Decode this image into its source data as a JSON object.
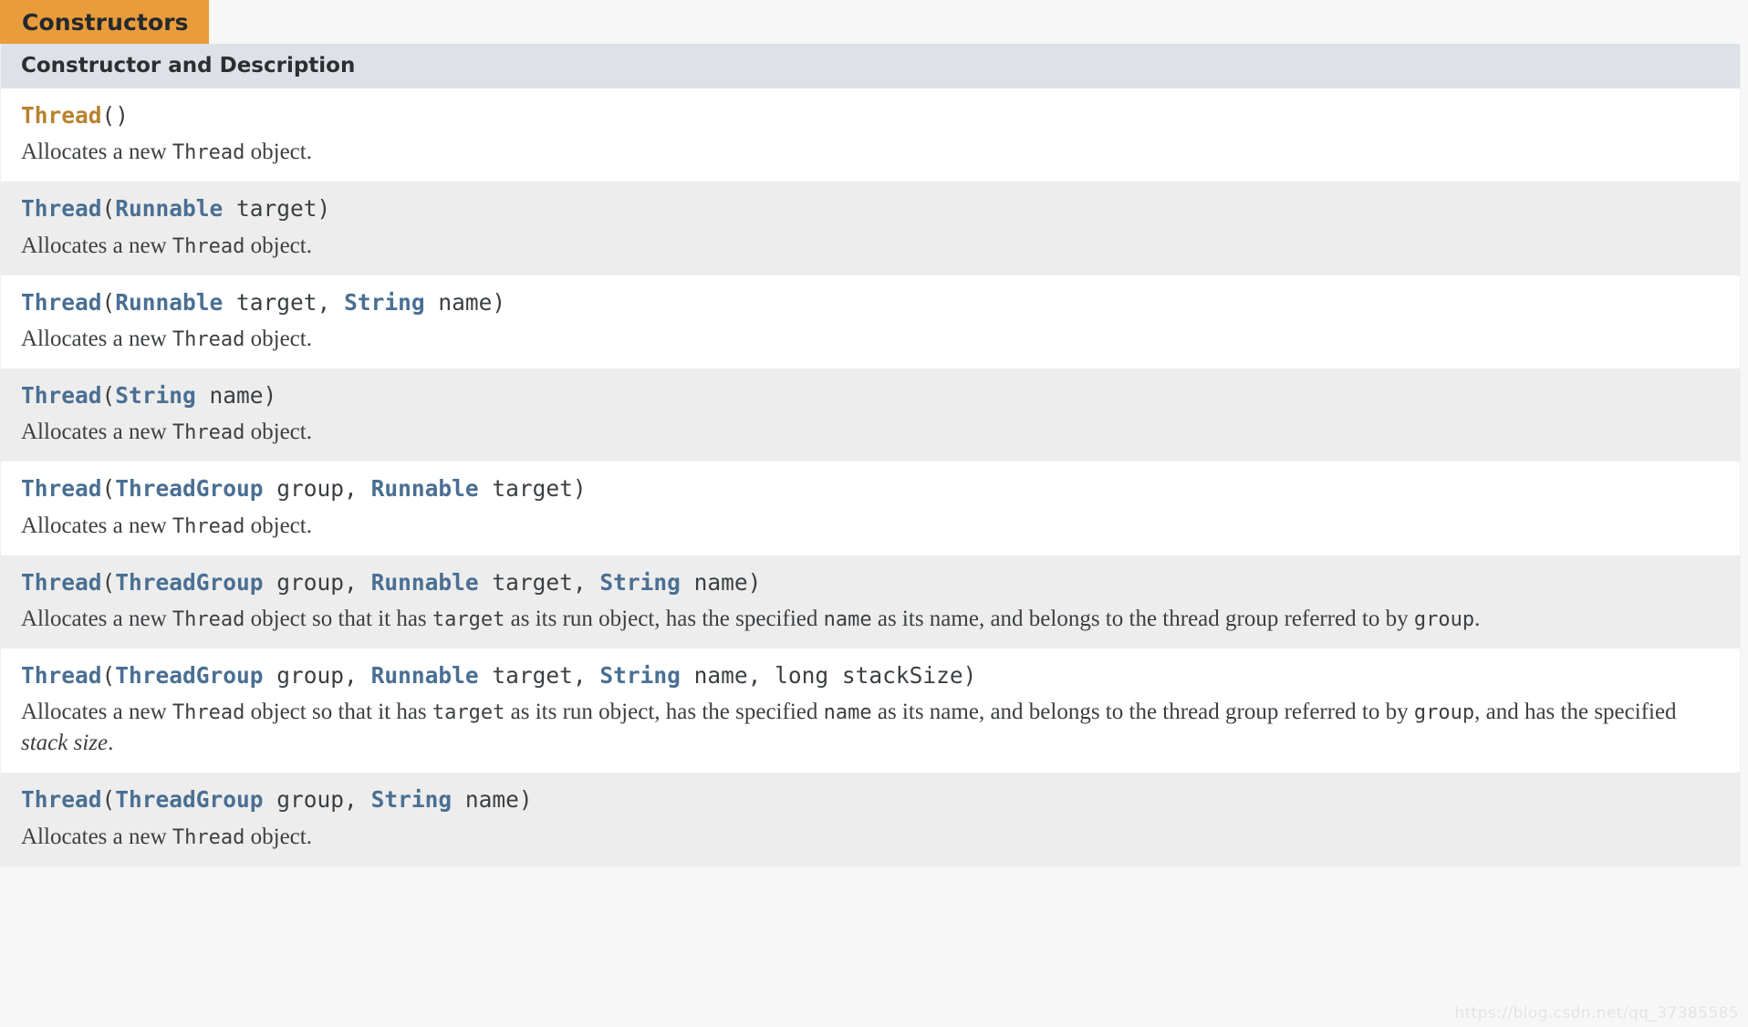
{
  "tab": {
    "label": "Constructors"
  },
  "column_header": {
    "label": "Constructor and Description"
  },
  "watermark": {
    "text": "https://blog.csdn.net/qq_37385585"
  },
  "colors": {
    "tab_background": "#e89c3c",
    "column_header_background": "#dee2e8",
    "row_odd_background": "#ffffff",
    "row_even_background": "#ededed",
    "type_link": "#4a6f93",
    "current_constructor": "#b8822f",
    "body_text": "#3c3f42"
  },
  "rows": [
    {
      "signature": {
        "name": "Thread",
        "highlight": true,
        "full_text": "Thread()",
        "parts": [
          {
            "text": "Thread",
            "style": "ctor-hl"
          },
          {
            "text": "()",
            "style": "punct"
          }
        ]
      },
      "description": {
        "full_text": "Allocates a new Thread object.",
        "parts": [
          {
            "text": "Allocates a new ",
            "style": "plain"
          },
          {
            "text": "Thread",
            "style": "code"
          },
          {
            "text": " object.",
            "style": "plain"
          }
        ]
      }
    },
    {
      "signature": {
        "name": "Thread",
        "highlight": false,
        "full_text": "Thread(Runnable target)",
        "parts": [
          {
            "text": "Thread",
            "style": "ctor"
          },
          {
            "text": "(",
            "style": "punct"
          },
          {
            "text": "Runnable",
            "style": "type"
          },
          {
            "text": " target)",
            "style": "param"
          }
        ]
      },
      "description": {
        "full_text": "Allocates a new Thread object.",
        "parts": [
          {
            "text": "Allocates a new ",
            "style": "plain"
          },
          {
            "text": "Thread",
            "style": "code"
          },
          {
            "text": " object.",
            "style": "plain"
          }
        ]
      }
    },
    {
      "signature": {
        "name": "Thread",
        "highlight": false,
        "full_text": "Thread(Runnable target, String name)",
        "parts": [
          {
            "text": "Thread",
            "style": "ctor"
          },
          {
            "text": "(",
            "style": "punct"
          },
          {
            "text": "Runnable",
            "style": "type"
          },
          {
            "text": " target, ",
            "style": "param"
          },
          {
            "text": "String",
            "style": "type"
          },
          {
            "text": " name)",
            "style": "param"
          }
        ]
      },
      "description": {
        "full_text": "Allocates a new Thread object.",
        "parts": [
          {
            "text": "Allocates a new ",
            "style": "plain"
          },
          {
            "text": "Thread",
            "style": "code"
          },
          {
            "text": " object.",
            "style": "plain"
          }
        ]
      }
    },
    {
      "signature": {
        "name": "Thread",
        "highlight": false,
        "full_text": "Thread(String name)",
        "parts": [
          {
            "text": "Thread",
            "style": "ctor"
          },
          {
            "text": "(",
            "style": "punct"
          },
          {
            "text": "String",
            "style": "type"
          },
          {
            "text": " name)",
            "style": "param"
          }
        ]
      },
      "description": {
        "full_text": "Allocates a new Thread object.",
        "parts": [
          {
            "text": "Allocates a new ",
            "style": "plain"
          },
          {
            "text": "Thread",
            "style": "code"
          },
          {
            "text": " object.",
            "style": "plain"
          }
        ]
      }
    },
    {
      "signature": {
        "name": "Thread",
        "highlight": false,
        "full_text": "Thread(ThreadGroup group, Runnable target)",
        "parts": [
          {
            "text": "Thread",
            "style": "ctor"
          },
          {
            "text": "(",
            "style": "punct"
          },
          {
            "text": "ThreadGroup",
            "style": "type"
          },
          {
            "text": " group, ",
            "style": "param"
          },
          {
            "text": "Runnable",
            "style": "type"
          },
          {
            "text": " target)",
            "style": "param"
          }
        ]
      },
      "description": {
        "full_text": "Allocates a new Thread object.",
        "parts": [
          {
            "text": "Allocates a new ",
            "style": "plain"
          },
          {
            "text": "Thread",
            "style": "code"
          },
          {
            "text": " object.",
            "style": "plain"
          }
        ]
      }
    },
    {
      "signature": {
        "name": "Thread",
        "highlight": false,
        "full_text": "Thread(ThreadGroup group, Runnable target, String name)",
        "parts": [
          {
            "text": "Thread",
            "style": "ctor"
          },
          {
            "text": "(",
            "style": "punct"
          },
          {
            "text": "ThreadGroup",
            "style": "type"
          },
          {
            "text": " group, ",
            "style": "param"
          },
          {
            "text": "Runnable",
            "style": "type"
          },
          {
            "text": " target, ",
            "style": "param"
          },
          {
            "text": "String",
            "style": "type"
          },
          {
            "text": " name)",
            "style": "param"
          }
        ]
      },
      "description": {
        "full_text": "Allocates a new Thread object so that it has target as its run object, has the specified name as its name, and belongs to the thread group referred to by group.",
        "parts": [
          {
            "text": "Allocates a new ",
            "style": "plain"
          },
          {
            "text": "Thread",
            "style": "code"
          },
          {
            "text": " object so that it has ",
            "style": "plain"
          },
          {
            "text": "target",
            "style": "code"
          },
          {
            "text": " as its run object, has the specified ",
            "style": "plain"
          },
          {
            "text": "name",
            "style": "code"
          },
          {
            "text": " as its name, and belongs to the thread group referred to by ",
            "style": "plain"
          },
          {
            "text": "group",
            "style": "code"
          },
          {
            "text": ".",
            "style": "plain"
          }
        ]
      }
    },
    {
      "signature": {
        "name": "Thread",
        "highlight": false,
        "full_text": "Thread(ThreadGroup group, Runnable target, String name, long stackSize)",
        "parts": [
          {
            "text": "Thread",
            "style": "ctor"
          },
          {
            "text": "(",
            "style": "punct"
          },
          {
            "text": "ThreadGroup",
            "style": "type"
          },
          {
            "text": " group, ",
            "style": "param"
          },
          {
            "text": "Runnable",
            "style": "type"
          },
          {
            "text": " target, ",
            "style": "param"
          },
          {
            "text": "String",
            "style": "type"
          },
          {
            "text": " name, long stackSize)",
            "style": "param"
          }
        ]
      },
      "description": {
        "full_text": "Allocates a new Thread object so that it has target as its run object, has the specified name as its name, and belongs to the thread group referred to by group, and has the specified stack size.",
        "parts": [
          {
            "text": "Allocates a new ",
            "style": "plain"
          },
          {
            "text": "Thread",
            "style": "code"
          },
          {
            "text": " object so that it has ",
            "style": "plain"
          },
          {
            "text": "target",
            "style": "code"
          },
          {
            "text": " as its run object, has the specified ",
            "style": "plain"
          },
          {
            "text": "name",
            "style": "code"
          },
          {
            "text": " as its name, and belongs to the thread group referred to by ",
            "style": "plain"
          },
          {
            "text": "group",
            "style": "code"
          },
          {
            "text": ", and has the specified ",
            "style": "plain"
          },
          {
            "text": "stack size",
            "style": "italic"
          },
          {
            "text": ".",
            "style": "plain"
          }
        ]
      }
    },
    {
      "signature": {
        "name": "Thread",
        "highlight": false,
        "full_text": "Thread(ThreadGroup group, String name)",
        "parts": [
          {
            "text": "Thread",
            "style": "ctor"
          },
          {
            "text": "(",
            "style": "punct"
          },
          {
            "text": "ThreadGroup",
            "style": "type"
          },
          {
            "text": " group, ",
            "style": "param"
          },
          {
            "text": "String",
            "style": "type"
          },
          {
            "text": " name)",
            "style": "param"
          }
        ]
      },
      "description": {
        "full_text": "Allocates a new Thread object.",
        "parts": [
          {
            "text": "Allocates a new ",
            "style": "plain"
          },
          {
            "text": "Thread",
            "style": "code"
          },
          {
            "text": " object.",
            "style": "plain"
          }
        ]
      }
    }
  ]
}
